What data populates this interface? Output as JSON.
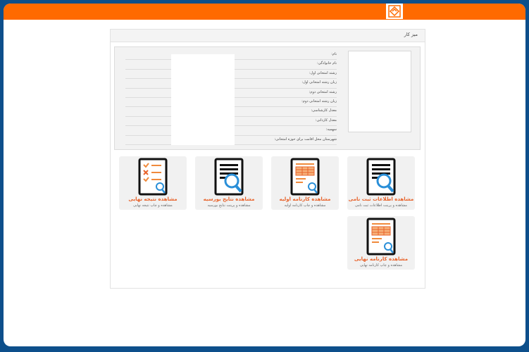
{
  "header": {
    "logo_icon": "logo-icon",
    "color": "#ff6a00"
  },
  "panel": {
    "title": "میز کار"
  },
  "info": {
    "labels": [
      "نام:",
      "نام خانوادگی:",
      "رشته امتحانی اول:",
      "زبان رشته امتحانی اول:",
      "رشته امتحانی دوم:",
      "زبان رشته امتحانی دوم:",
      "معدل کارشناسی:",
      "معدل کاردانی:",
      "سهمیه:",
      "شهرستان محل اقامت برای حوزه امتحانی:"
    ]
  },
  "cards": [
    {
      "title": "مشاهده اطلاعات ثبت نامی",
      "subtitle": "مشاهده و پرینت اطلاعات ثبت نامی",
      "icon": "document-search-icon"
    },
    {
      "title": "مشاهده کارنامه اولیه",
      "subtitle": "مشاهده و چاپ کارنامه اولیه",
      "icon": "report-card-icon"
    },
    {
      "title": "مشاهده نتایج بورسیه",
      "subtitle": "مشاهده و پرینت نتایج بورسیه",
      "icon": "document-search-icon"
    },
    {
      "title": "مشاهده نتیجه نهایی",
      "subtitle": "مشاهده و چاپ نتیجه نهایی",
      "icon": "checklist-icon"
    },
    {
      "title": "مشاهده کارنامه نهایی",
      "subtitle": "مشاهده و چاپ کارنامه نهایی",
      "icon": "report-card-icon"
    }
  ],
  "colors": {
    "accent": "#e8622a",
    "frame": "#0d4f8b",
    "icon_blue": "#2a8fd8"
  }
}
